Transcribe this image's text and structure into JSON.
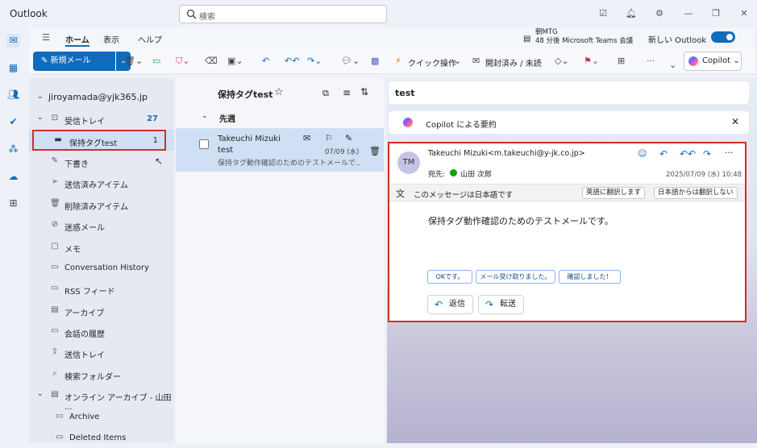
{
  "app": {
    "title": "Outlook"
  },
  "search": {
    "placeholder": "検索"
  },
  "ribbon": {
    "tabs": [
      "ホーム",
      "表示",
      "ヘルプ"
    ]
  },
  "meeting": {
    "title": "朝MTG",
    "subtitle": "48 分後 Microsoft Teams 会議"
  },
  "new_outlook": {
    "label": "新しい Outlook",
    "enabled": true
  },
  "toolbar": {
    "new_mail": "新規メール",
    "quick_action": "クイック操作",
    "read_unread": "開封済み / 未読",
    "copilot": "Copilot"
  },
  "account": "jiroyamada@yjk365.jp",
  "folders": [
    {
      "label": "受信トレイ",
      "count": "27"
    },
    {
      "label": "保持タグtest",
      "count": "1"
    },
    {
      "label": "下書き"
    },
    {
      "label": "送信済みアイテム"
    },
    {
      "label": "削除済みアイテム"
    },
    {
      "label": "迷惑メール"
    },
    {
      "label": "メモ"
    },
    {
      "label": "Conversation History"
    },
    {
      "label": "RSS フィード"
    },
    {
      "label": "アーカイブ"
    },
    {
      "label": "会話の履歴"
    },
    {
      "label": "送信トレイ"
    },
    {
      "label": "検索フォルダー"
    },
    {
      "label": "オンライン アーカイブ - 山田 ..."
    },
    {
      "label": "Archive"
    },
    {
      "label": "Deleted Items"
    }
  ],
  "message_list": {
    "folder_title": "保持タグtest",
    "section": "先週",
    "message": {
      "sender": "Takeuchi Mizuki",
      "subject": "test",
      "preview": "保持タグ動作確認のためのテストメールで...",
      "date": "07/09 (水)"
    }
  },
  "reading": {
    "subject": "test",
    "copilot_summary": "Copilot による要約",
    "sender": "Takeuchi Mizuki<m.takeuchi@y-jk.co.jp>",
    "avatar_initials": "TM",
    "to_label": "宛先:",
    "to_name": "山田 次郎",
    "datetime": "2025/07/09 (水) 10:48",
    "translate_notice": "このメッセージは日本語です",
    "translate_btn": "英語に翻訳します",
    "no_translate_btn": "日本語からは翻訳しない",
    "body": "保持タグ動作確認のためのテストメールです。",
    "quick_replies": [
      "OKです。",
      "メール受け取りました。",
      "確認しました！"
    ],
    "reply": "返信",
    "forward": "転送"
  },
  "colors": {
    "accent": "#0f6cbd",
    "highlight": "#d62a2a"
  }
}
